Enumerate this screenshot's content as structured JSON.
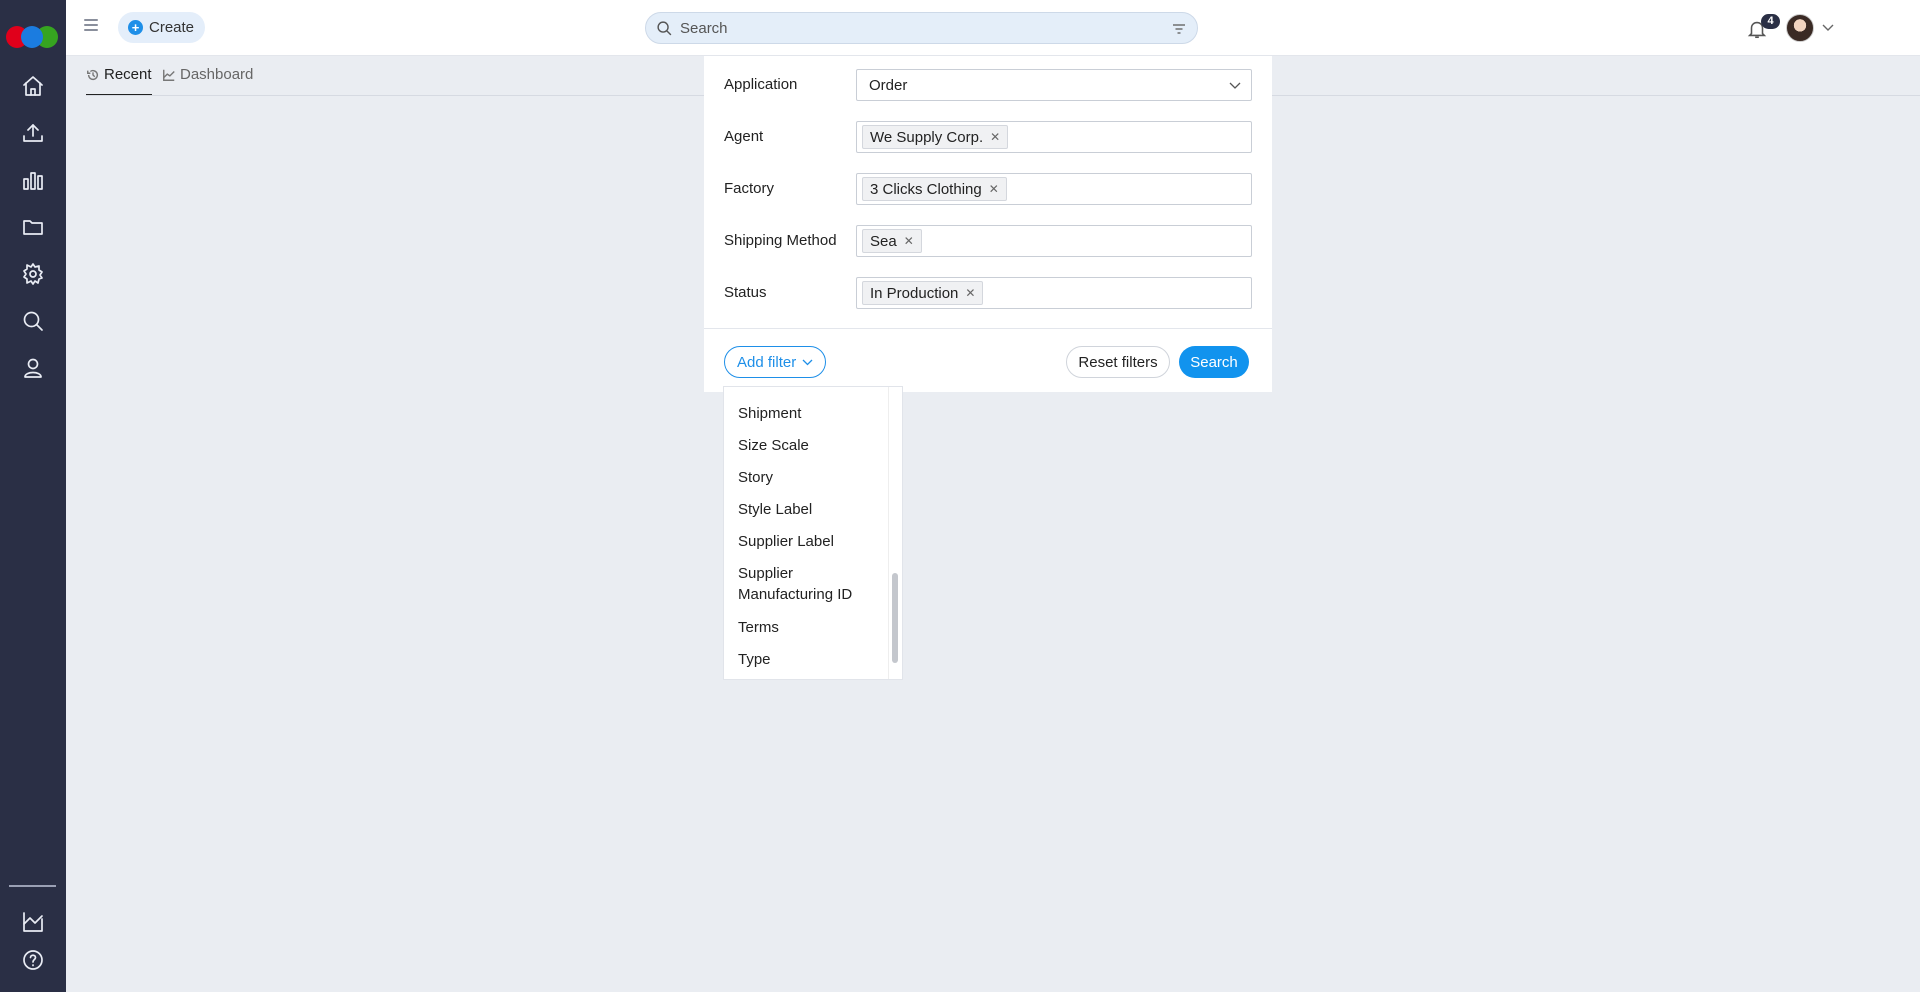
{
  "header": {
    "create_label": "Create",
    "search_placeholder": "Search",
    "notifications_count": "4"
  },
  "tabs": [
    {
      "label": "Recent",
      "active": true
    },
    {
      "label": "Dashboard",
      "active": false
    }
  ],
  "filters": {
    "application": {
      "label": "Application",
      "value": "Order"
    },
    "agent": {
      "label": "Agent",
      "tags": [
        "We Supply Corp."
      ]
    },
    "factory": {
      "label": "Factory",
      "tags": [
        "3 Clicks Clothing"
      ]
    },
    "shipping": {
      "label": "Shipping Method",
      "tags": [
        "Sea"
      ]
    },
    "status": {
      "label": "Status",
      "tags": [
        "In Production"
      ]
    }
  },
  "actions": {
    "add_filter": "Add filter",
    "reset": "Reset filters",
    "search": "Search"
  },
  "dropdown": {
    "items": [
      "Shipment",
      "Size Scale",
      "Story",
      "Style Label",
      "Supplier Label",
      "Supplier Manufacturing ID",
      "Terms",
      "Type"
    ]
  },
  "colors": {
    "sidebar": "#2a2f45",
    "accent": "#1193ee",
    "background": "#eaedf2"
  }
}
